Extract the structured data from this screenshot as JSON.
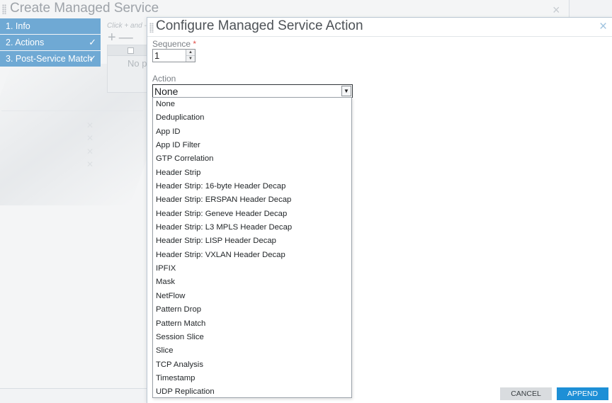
{
  "background_dialog": {
    "title": "Create Managed Service",
    "close_symbol": "×",
    "steps": [
      {
        "label": "1. Info",
        "check": ""
      },
      {
        "label": "2. Actions",
        "check": "✓"
      },
      {
        "label": "3. Post-Service Match",
        "check": "✓"
      }
    ],
    "hint": "Click + and - t",
    "toolbar_add": "+",
    "toolbar_remove": "—",
    "table_placeholder": "No p"
  },
  "dialog": {
    "title": "Configure Managed Service Action",
    "close_symbol": "×",
    "sequence": {
      "label": "Sequence",
      "required_mark": "*",
      "value": "1"
    },
    "action": {
      "label": "Action",
      "selected": "None",
      "options": [
        "None",
        "Deduplication",
        "App ID",
        "App ID Filter",
        "GTP Correlation",
        "Header Strip",
        "Header Strip: 16-byte Header Decap",
        "Header Strip: ERSPAN Header Decap",
        "Header Strip: Geneve Header Decap",
        "Header Strip: L3 MPLS Header Decap",
        "Header Strip: LISP Header Decap",
        "Header Strip: VXLAN Header Decap",
        "IPFIX",
        "Mask",
        "NetFlow",
        "Pattern Drop",
        "Pattern Match",
        "Session Slice",
        "Slice",
        "TCP Analysis",
        "Timestamp",
        "UDP Replication"
      ]
    },
    "buttons": {
      "cancel": "CANCEL",
      "append": "APPEND"
    }
  },
  "icons": {
    "spinner_up": "▲",
    "spinner_down": "▼",
    "dropdown_arrow": "▼"
  },
  "colors": {
    "step_active": "#6fa9d4",
    "append_button": "#1d8fd6",
    "required": "#e0504a"
  }
}
